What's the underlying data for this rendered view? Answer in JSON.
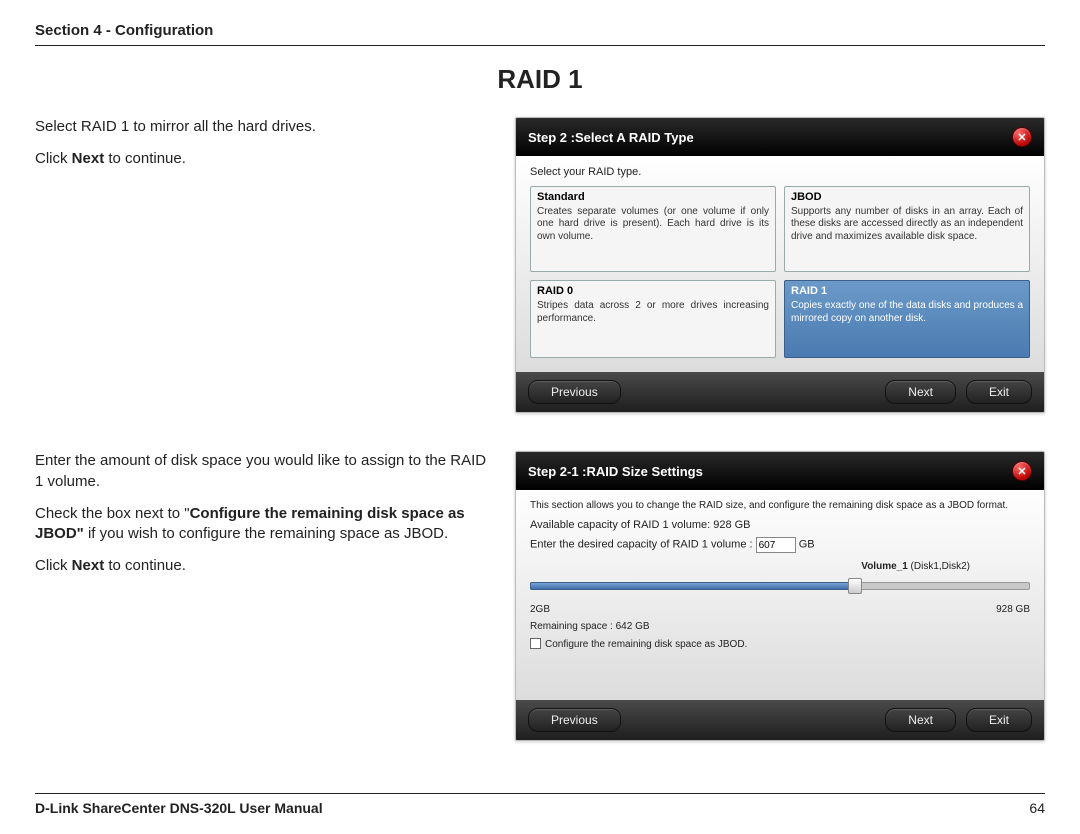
{
  "header": {
    "section": "Section 4 - Configuration"
  },
  "title": "RAID 1",
  "block1": {
    "p1": "Select RAID 1 to mirror all the hard drives.",
    "p2a": "Click ",
    "p2b": "Next",
    "p2c": " to continue."
  },
  "wizard1": {
    "title": "Step 2 :Select A RAID Type",
    "intro": "Select your RAID type.",
    "options": {
      "standard": {
        "title": "Standard",
        "desc": "Creates separate volumes (or one volume if only one hard drive is present). Each hard drive is its own volume."
      },
      "jbod": {
        "title": "JBOD",
        "desc": "Supports any number of disks in an array. Each of these disks are accessed directly as an independent drive and maximizes available disk space."
      },
      "raid0": {
        "title": "RAID 0",
        "desc": "Stripes data across 2 or more drives increasing performance."
      },
      "raid1": {
        "title": "RAID 1",
        "desc": "Copies exactly one of the data disks and produces a mirrored copy on another disk."
      }
    },
    "buttons": {
      "prev": "Previous",
      "next": "Next",
      "exit": "Exit"
    }
  },
  "block2": {
    "p1": "Enter the amount of disk space you would like to assign to the RAID 1 volume.",
    "p2a": "Check the box next to \"",
    "p2b": "Configure the remaining disk space as JBOD\"",
    "p2c": " if you wish to configure the remaining space as JBOD.",
    "p3a": "Click ",
    "p3b": "Next",
    "p3c": " to continue."
  },
  "wizard2": {
    "title": "Step 2-1 :RAID Size Settings",
    "intro": "This section allows you to change the RAID size, and configure the remaining disk space as a JBOD format.",
    "available": "Available capacity of RAID 1 volume: 928 GB",
    "enter_label": "Enter the desired capacity of RAID 1 volume :",
    "enter_value": "607",
    "enter_unit": "GB",
    "volume_label_b": "Volume_1",
    "volume_label_rest": " (Disk1,Disk2)",
    "min": "2GB",
    "max": "928 GB",
    "remaining": "Remaining space : 642 GB",
    "chk_label": "Configure the remaining disk space as JBOD.",
    "buttons": {
      "prev": "Previous",
      "next": "Next",
      "exit": "Exit"
    }
  },
  "footer": {
    "manual": "D-Link ShareCenter DNS-320L User Manual",
    "page": "64"
  }
}
